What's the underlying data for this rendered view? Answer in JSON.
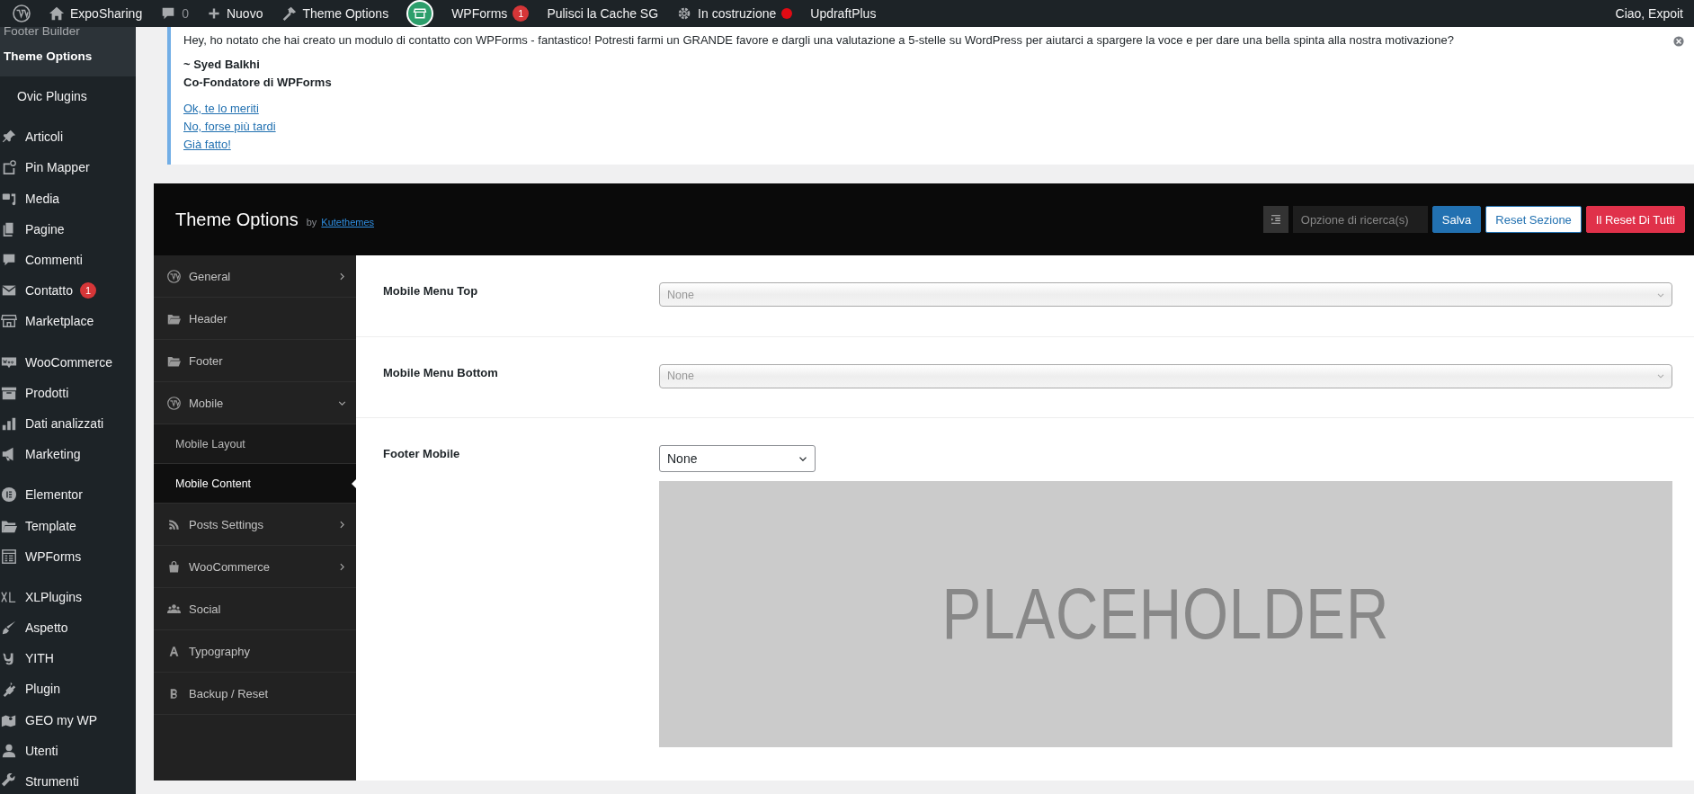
{
  "admin_bar": {
    "items": [
      {
        "kind": "logo"
      },
      {
        "kind": "site",
        "label": "ExpoSharing"
      },
      {
        "kind": "comments",
        "label": "0"
      },
      {
        "kind": "new",
        "label": "Nuovo"
      },
      {
        "kind": "theme",
        "label": "Theme Options"
      },
      {
        "kind": "avatar"
      },
      {
        "kind": "plain",
        "label": "WPForms",
        "badge": "1"
      },
      {
        "kind": "plain",
        "label": "Pulisci la Cache SG"
      },
      {
        "kind": "status",
        "label": "In costruzione"
      },
      {
        "kind": "plain",
        "label": "UpdraftPlus"
      }
    ],
    "account": "Ciao, Expoit"
  },
  "sidebar": {
    "submenu": [
      {
        "label": "Footer Builder",
        "selected": false
      },
      {
        "label": "Theme Options",
        "selected": true
      }
    ],
    "items": [
      {
        "label": "Ovic Plugins"
      },
      {
        "label": "Articoli"
      },
      {
        "label": "Pin Mapper"
      },
      {
        "label": "Media"
      },
      {
        "label": "Pagine"
      },
      {
        "label": "Commenti"
      },
      {
        "label": "Contatto",
        "badge": "1"
      },
      {
        "label": "Marketplace"
      },
      {
        "label": "WooCommerce"
      },
      {
        "label": "Prodotti"
      },
      {
        "label": "Dati analizzati"
      },
      {
        "label": "Marketing"
      },
      {
        "label": "Elementor"
      },
      {
        "label": "Template"
      },
      {
        "label": "WPForms"
      },
      {
        "label": "XLPlugins"
      },
      {
        "label": "Aspetto"
      },
      {
        "label": "YITH"
      },
      {
        "label": "Plugin"
      },
      {
        "label": "GEO my WP"
      },
      {
        "label": "Utenti"
      },
      {
        "label": "Strumenti"
      }
    ]
  },
  "notice": {
    "message": "Hey, ho notato che hai creato un modulo di contatto con WPForms - fantastico! Potresti farmi un GRANDE favore e dargli una valutazione a 5-stelle su WordPress per aiutarci a spargere la voce e per dare una bella spinta alla nostra motivazione?",
    "signature": [
      "~ Syed Balkhi",
      "Co-Fondatore di WPForms"
    ],
    "links": [
      "Ok, te lo meriti",
      "No, forse più tardi",
      "Già fatto!"
    ]
  },
  "theme_options": {
    "title": "Theme Options",
    "by": "by",
    "author": "Kutethemes",
    "search": {
      "placeholder": "Opzione di ricerca(s)"
    },
    "buttons": [
      {
        "label": "Salva",
        "kind": "primary"
      },
      {
        "label": "Reset Sezione",
        "kind": "secondary"
      },
      {
        "label": "Il Reset Di Tutti",
        "kind": "danger"
      }
    ],
    "nav": [
      {
        "label": "General",
        "kind": "group",
        "expanded": false,
        "selected": false
      },
      {
        "label": "Header",
        "kind": "page",
        "selected": false
      },
      {
        "label": "Footer",
        "kind": "page",
        "selected": false
      },
      {
        "label": "Mobile",
        "kind": "group",
        "expanded": true,
        "selected": false,
        "children": [
          {
            "label": "Mobile Layout",
            "selected": false
          },
          {
            "label": "Mobile Content",
            "selected": true
          }
        ]
      },
      {
        "label": "Posts Settings",
        "kind": "group",
        "expanded": false,
        "selected": false
      },
      {
        "label": "WooCommerce",
        "kind": "group",
        "expanded": false,
        "selected": false
      },
      {
        "label": "Social",
        "kind": "page",
        "selected": false
      },
      {
        "label": "Typography",
        "kind": "page",
        "selected": false
      },
      {
        "label": "Backup / Reset",
        "kind": "page",
        "selected": false
      }
    ],
    "fields": [
      {
        "label": "Mobile Menu Top",
        "kind": "select2",
        "placeholder": "None"
      },
      {
        "label": "Mobile Menu Bottom",
        "kind": "select2",
        "placeholder": "None"
      },
      {
        "label": "Footer Mobile",
        "kind": "select",
        "value": "None",
        "preview": "PLACEHOLDER"
      }
    ]
  }
}
